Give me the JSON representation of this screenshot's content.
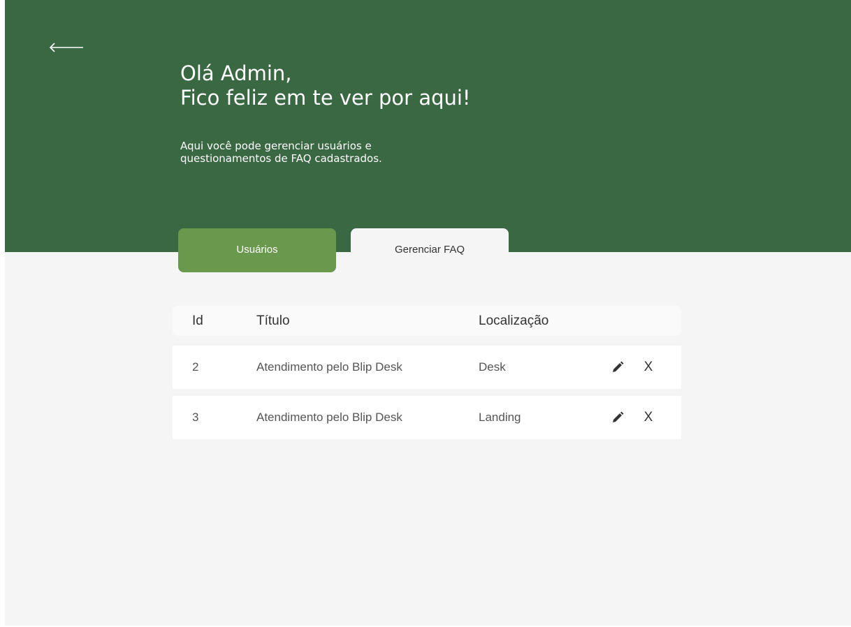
{
  "header": {
    "greeting_line1": "Olá Admin,",
    "greeting_line2": "Fico feliz em te ver por aqui!",
    "description": "Aqui você pode gerenciar usuários e questionamentos de FAQ cadastrados.",
    "back_icon": "arrow-left-icon"
  },
  "tabs": [
    {
      "label": "Usuários",
      "active": false
    },
    {
      "label": "Gerenciar FAQ",
      "active": true
    }
  ],
  "table": {
    "headers": [
      "Id",
      "Título",
      "Localização"
    ],
    "rows": [
      {
        "id": "2",
        "title": "Atendimento pelo Blip Desk",
        "location": "Desk"
      },
      {
        "id": "3",
        "title": "Atendimento pelo Blip Desk",
        "location": "Landing"
      }
    ],
    "edit_icon": "pencil-icon",
    "delete_label": "X"
  },
  "colors": {
    "hero": "#396843",
    "tab_active": "#6a994e",
    "page_bg": "#f5f5f5"
  }
}
